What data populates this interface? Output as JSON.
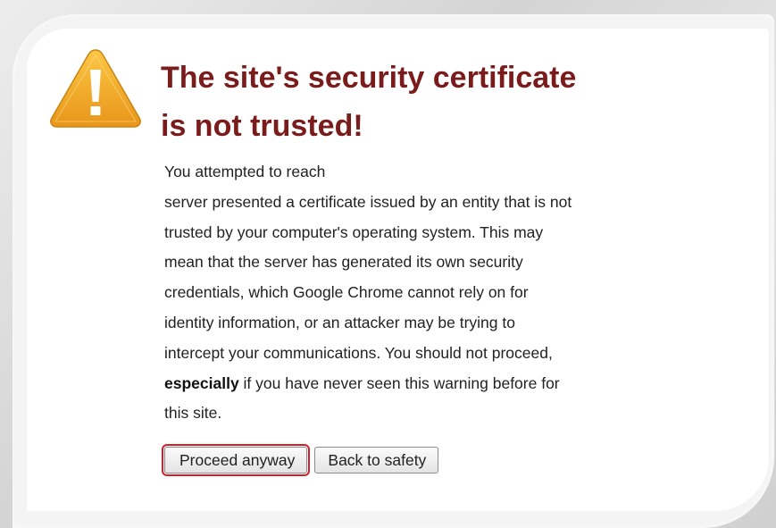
{
  "colors": {
    "title": "#7a1c1c",
    "warning_icon_fill": "#f2a91e",
    "highlight_outline": "#d31f2a"
  },
  "icon": "warning-triangle-icon",
  "title": {
    "line1": "The site's security certificate",
    "line2": "is not trusted!"
  },
  "body": {
    "line1": "You attempted to reach",
    "line2": "server presented a certificate issued by an entity that is not",
    "line3": "trusted by your computer's operating system. This may",
    "line4": "mean that the server has generated its own security",
    "line5": "credentials, which Google Chrome cannot rely on for",
    "line6": "identity information, or an attacker may be trying to",
    "line7": "intercept your communications. You should not proceed,",
    "line8_bold": "especially",
    "line8_rest": " if you have never seen this warning before for",
    "line9": "this site."
  },
  "buttons": {
    "proceed_label": "Proceed anyway",
    "back_label": "Back to safety"
  }
}
